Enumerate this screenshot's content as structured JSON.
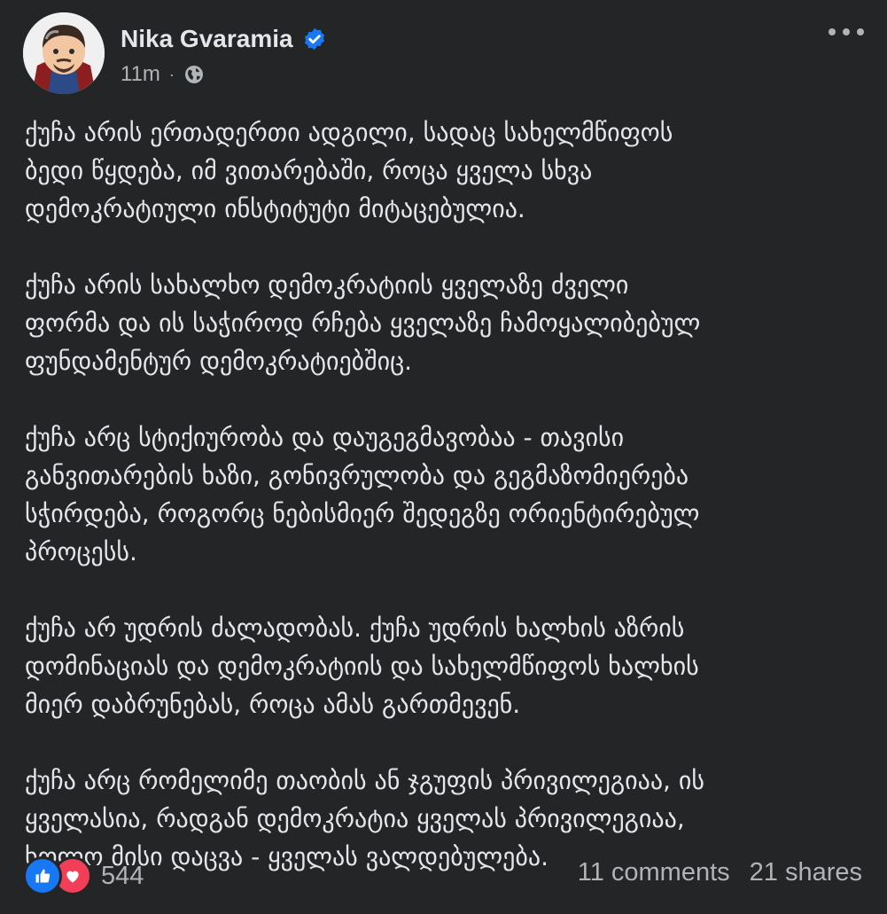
{
  "post": {
    "author": "Nika Gvaramia",
    "time": "11m",
    "separator": "·",
    "paragraphs": [
      "ქუჩა არის ერთადერთი ადგილი, სადაც სახელმწიფოს\nბედი წყდება, იმ ვითარებაში, როცა ყველა სხვა\nდემოკრატიული ინსტიტუტი მიტაცებულია.",
      "ქუჩა არის სახალხო დემოკრატიის ყველაზე ძველი\nფორმა და ის საჭიროდ რჩება ყველაზე ჩამოყალიბებულ\nფუნდამენტურ დემოკრატიებშიც.",
      "ქუჩა არც სტიქიურობა და დაუგეგმავობაა - თავისი\nგანვითარების ხაზი, გონივრულობა და გეგმაზომიერება\nსჭირდება, როგორც ნებისმიერ შედეგზე ორიენტირებულ\nპროცესს.",
      "ქუჩა არ უდრის ძალადობას. ქუჩა უდრის ხალხის აზრის\nდომინაციას და დემოკრატიის და სახელმწიფოს ხალხის\nმიერ დაბრუნებას, როცა ამას გართმევენ.",
      "ქუჩა არც რომელიმე თაობის ან ჯგუფის პრივილეგიაა, ის\nყველასია, რადგან დემოკრატია ყველას პრივილეგიაა,\nხოლო მისი დაცვა - ყველას ვალდებულება."
    ]
  },
  "footer": {
    "reaction_count": "544",
    "comments": "11 comments",
    "shares": "21 shares"
  },
  "icons": {
    "verified": "verified-badge-icon",
    "audience": "globe-icon",
    "more": "more-options-icon",
    "like": "like-icon",
    "love": "love-icon"
  },
  "colors": {
    "background": "#242526",
    "text": "#e4e6eb",
    "secondary": "#b0b3b8",
    "brand_blue": "#1877f2",
    "love_red": "#f33e58"
  }
}
